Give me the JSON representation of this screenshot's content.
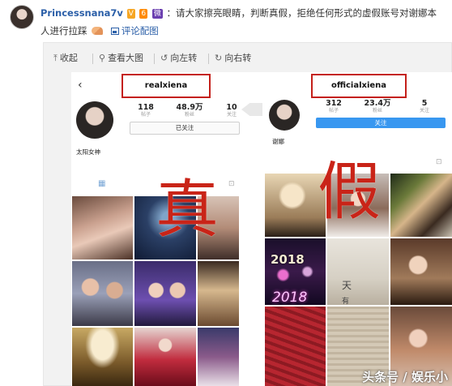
{
  "post": {
    "username": "Princessnana7v",
    "badge_v": "V",
    "badge_level": "6",
    "badge_vip": "微",
    "content": "：请大家擦亮眼睛，判断真假，拒绝任何形式的虚假账号对谢娜本人进行拉踩",
    "comment_pic_label": "评论配图"
  },
  "toolbar": {
    "collapse": "收起",
    "view_large": "查看大图",
    "rotate_left": "向左转",
    "rotate_right": "向右转"
  },
  "left_profile": {
    "handle": "realxiena",
    "stat1_num": "118",
    "stat1_label": "帖子",
    "stat2_num": "48.9万",
    "stat2_label": "粉丝",
    "stat3_num": "10",
    "stat3_label": "关注",
    "follow_button": "已关注",
    "name": "太阳女神"
  },
  "right_profile": {
    "handle": "officialxiena",
    "stat1_num": "312",
    "stat1_label": "帖子",
    "stat2_num": "23.4万",
    "stat2_label": "粉丝",
    "stat3_num": "5",
    "stat3_label": "关注",
    "follow_button": "关注",
    "name": "谢娜"
  },
  "overlay": {
    "true_char": "真",
    "fake_char": "假"
  },
  "photo_text": {
    "year_1": "2018",
    "year_2": "2018",
    "card_text_1": "天",
    "card_text_2": "有"
  },
  "watermark": "头条号 / 娱乐小"
}
